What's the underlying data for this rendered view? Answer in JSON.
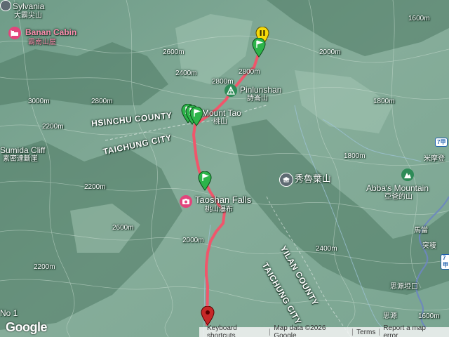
{
  "map": {
    "labels": {
      "sylvania": "Sylvania",
      "sylvania_zh": "大霸尖山",
      "banan_cabin": "Banan Cabin",
      "banan_cabin_zh": "霸南山屋",
      "pinlunshan": "Pinlunshan",
      "pinlunshan_zh": "詩崙山",
      "mount_tao": "Mount Tao",
      "mount_tao_zh": "桃山",
      "hsinchu_county": "HSINCHU COUNTY",
      "taichung_city_top": "TAICHUNG CITY",
      "sumida_cliff": "Sumida Cliff",
      "sumida_cliff_zh": "素密達斷崖",
      "xiuluye": "秀魯葉山",
      "taoshan_falls": "Taoshan Falls",
      "taoshan_falls_zh": "桃山瀑布",
      "abbas_mountain": "Abba's Mountain",
      "abbas_mountain_zh": "亞爸的山",
      "yilan_county": "YILAN COUNTY",
      "taichung_city_bottom": "TAICHUNG CITY",
      "mimoden": "米摩登",
      "madang": "馬當",
      "tuwen": "突稜",
      "siyuan_yakou": "思源埡口",
      "siyuan": "思源",
      "no1": "No 1",
      "route_7a": "7甲",
      "route_7a_2": "7甲"
    },
    "contours": {
      "c1": "2800m",
      "c2": "2600m",
      "c3": "2400m",
      "c4": "2200m",
      "c5": "2000m",
      "c6": "1800m",
      "c7": "1600m",
      "c8": "1800m",
      "c9": "2000m",
      "c10": "2200m",
      "c11": "2600m",
      "c12": "2400m",
      "c13": "1600m",
      "c14": "2200m",
      "c15": "2800m",
      "c16": "2800m",
      "c17": "3000m"
    },
    "icons": {
      "banan_cabin": "lodging-icon",
      "pinlunshan": "mountain-icon",
      "xiuluye": "landmark-icon",
      "taoshan_falls": "camera-icon",
      "abbas_mountain": "mountain-icon",
      "pause_marker": "pause-marker-icon",
      "waypoint_marker": "waypoint-marker-icon",
      "end_marker": "end-marker-icon"
    },
    "colors": {
      "track": "#f0566b",
      "start_marker": "#c62828",
      "waypoint_marker": "#2db44a",
      "pause_marker": "#f5d90a",
      "poi_pink": "#e2457c"
    }
  },
  "footer": {
    "google_logo": "Google",
    "keyboard_shortcuts": "Keyboard shortcuts",
    "map_data": "Map data ©2026 Google",
    "terms": "Terms",
    "report": "Report a map error"
  }
}
